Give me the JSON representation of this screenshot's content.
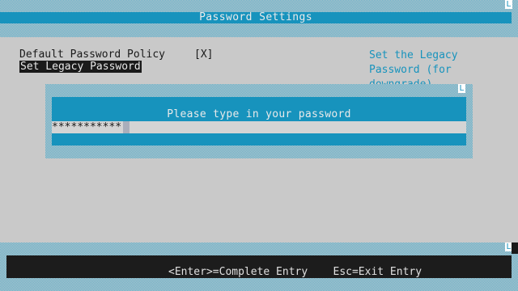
{
  "header": {
    "title": "Password Settings",
    "corner_glyph": "L"
  },
  "menu": {
    "items": [
      {
        "label": "Default Password Policy",
        "value": "[X]"
      },
      {
        "label": "Set Legacy Password"
      }
    ]
  },
  "help": {
    "text": "Set the Legacy\nPassword (for\ndowngrade)"
  },
  "dialog": {
    "prompt": "Please type in your password",
    "password_value": "***********",
    "corner_glyph": "L"
  },
  "footer": {
    "hints": "<Enter>=Complete Entry    Esc=Exit Entry",
    "corner_glyph": "L"
  },
  "colors": {
    "background": "#c9c9c9",
    "accent_blue": "#1793bd",
    "help_text": "#1793bd",
    "highlight_bg": "#1a1a1a",
    "footer_bg": "#1c1c1c",
    "cursor": "#a9aebb"
  }
}
